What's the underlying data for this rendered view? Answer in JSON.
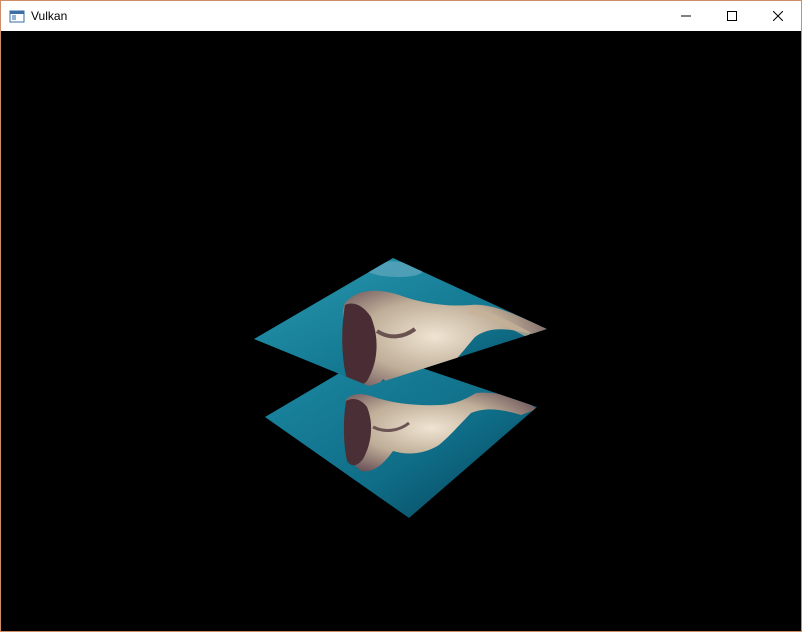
{
  "window": {
    "title": "Vulkan",
    "controls": {
      "minimize_icon": "minimize-icon",
      "maximize_icon": "maximize-icon",
      "close_icon": "close-icon"
    }
  },
  "scene": {
    "background": "#000000",
    "planes": [
      {
        "name": "upper-textured-plane",
        "texture": "statue-head-texture"
      },
      {
        "name": "lower-textured-plane",
        "texture": "statue-head-texture"
      }
    ],
    "colors": {
      "sky_light": "#2a98b0",
      "sky_dark": "#064a62",
      "stone_light": "#e8dcc8",
      "stone_dark": "#4a3038"
    }
  }
}
